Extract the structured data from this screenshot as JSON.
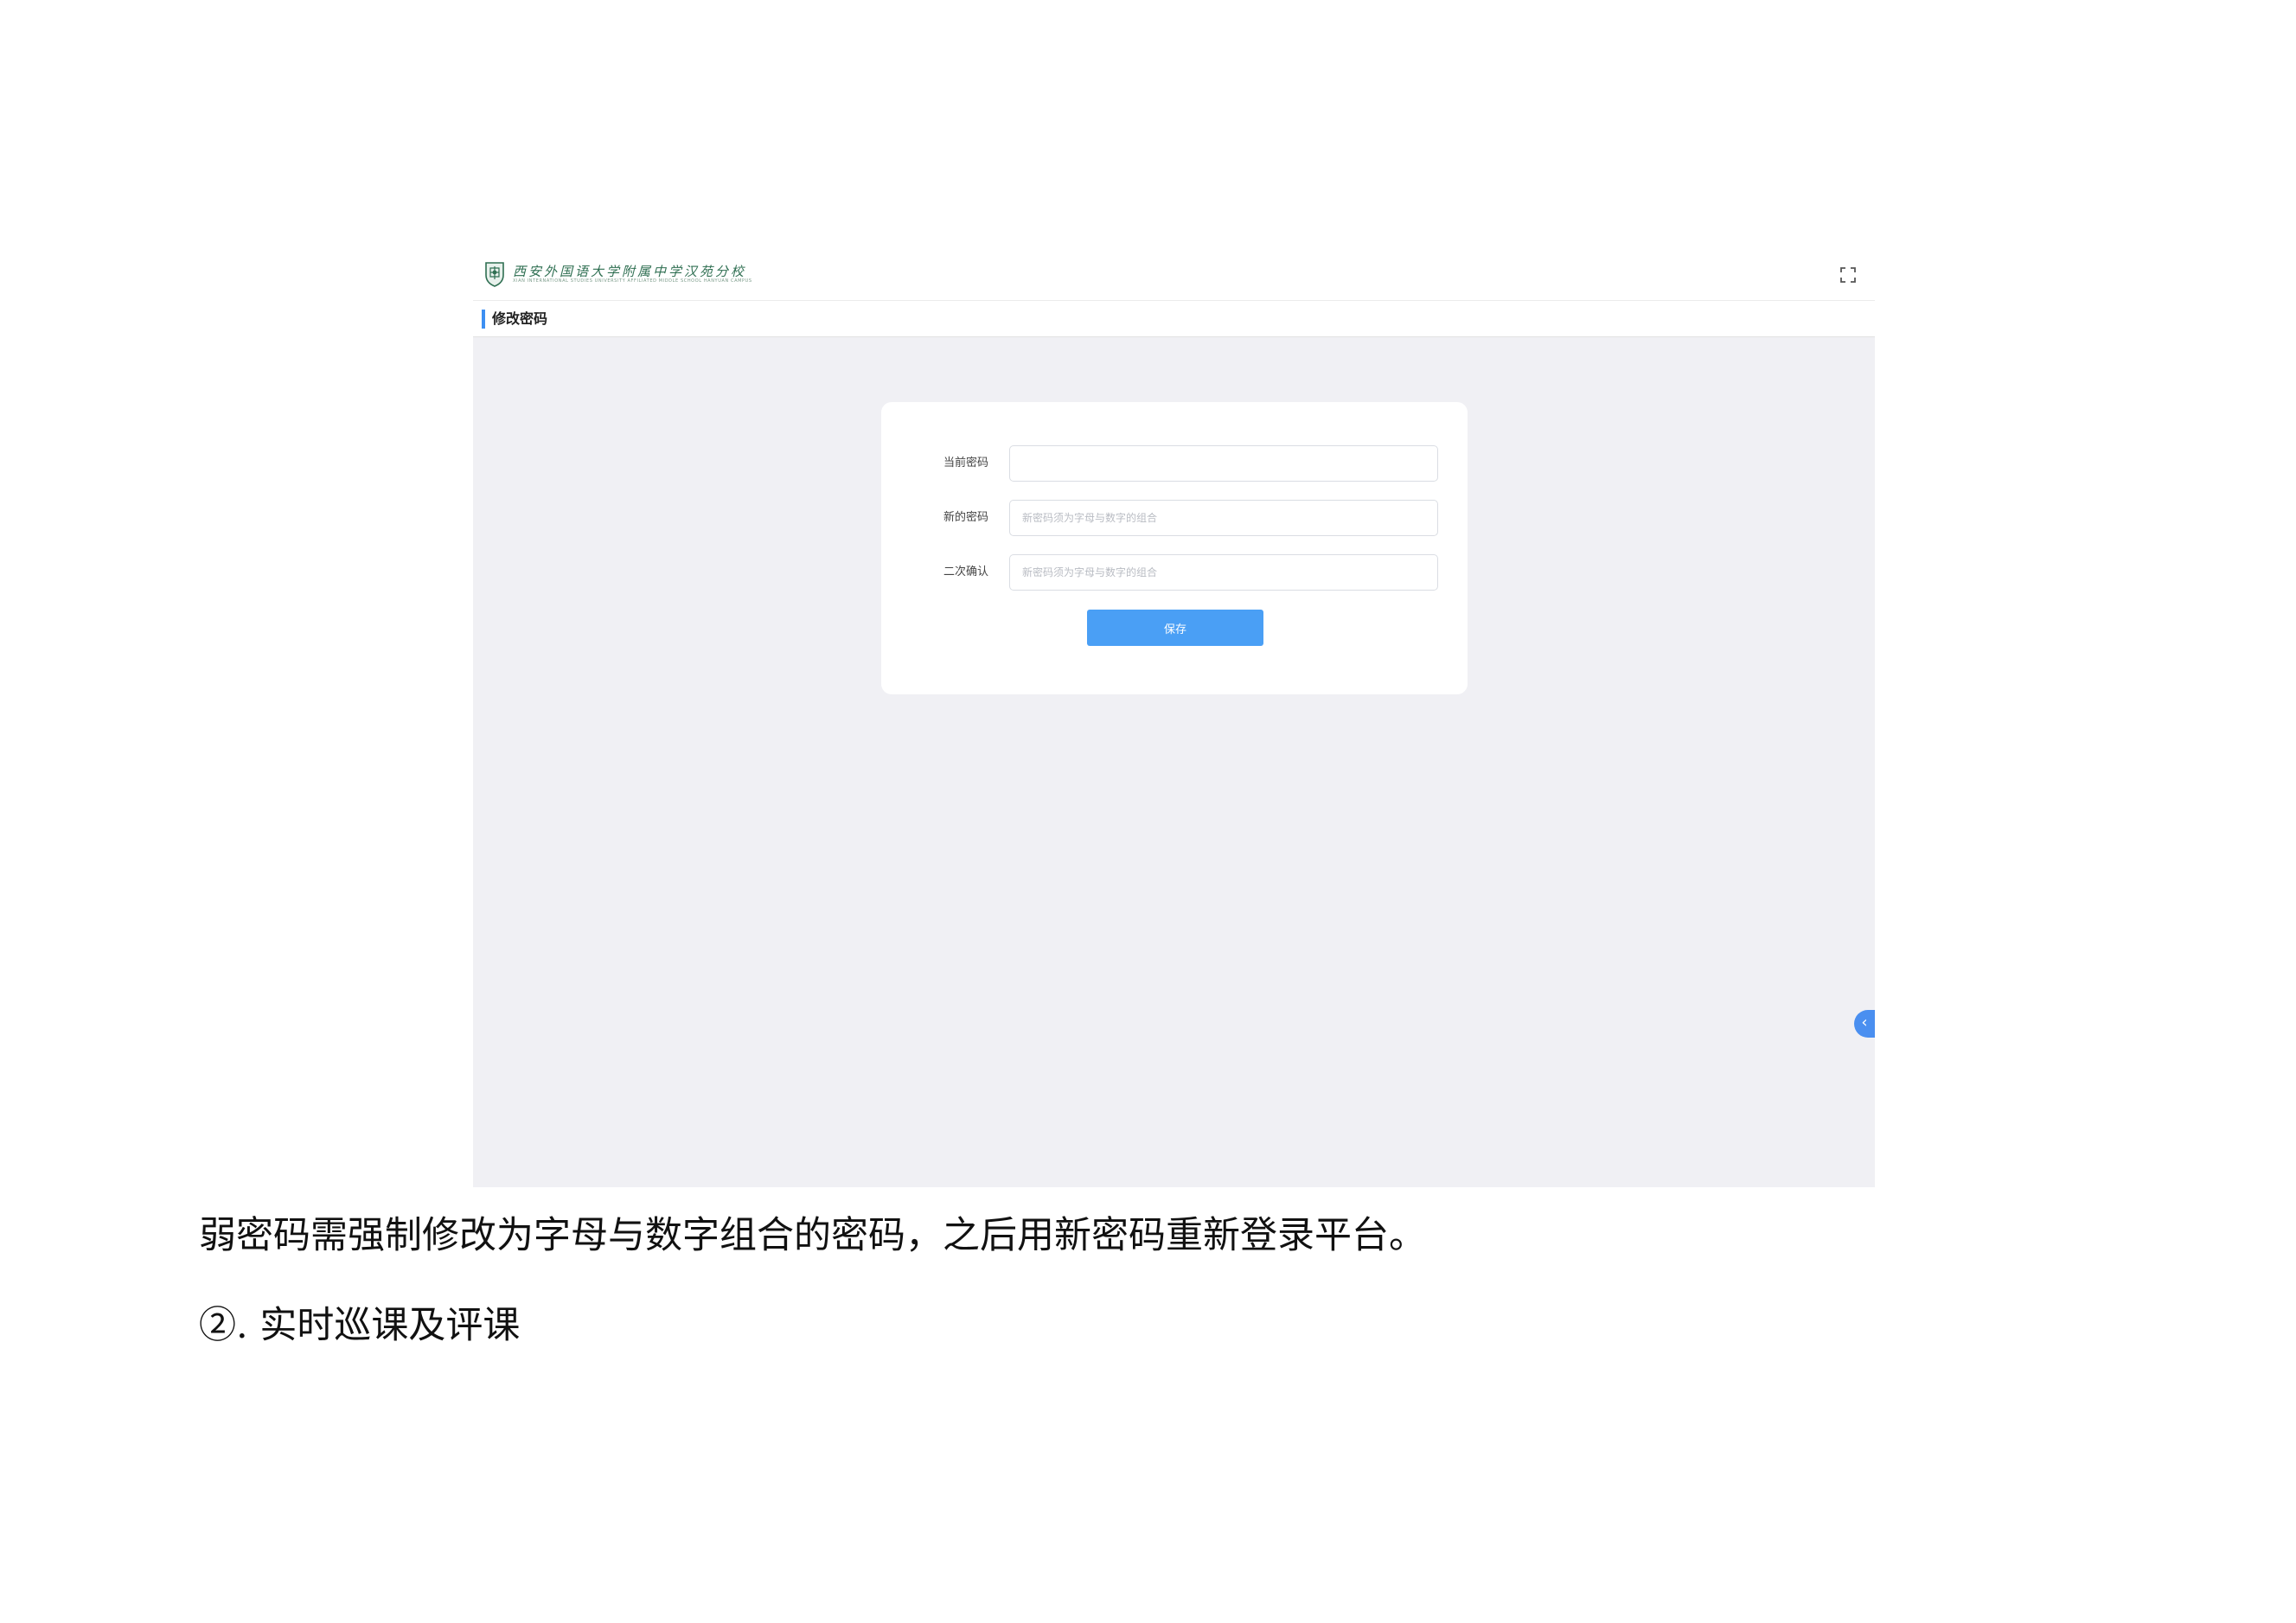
{
  "screenshot": {
    "topbar": {
      "logo_main": "西安外国语大学附属中学汉苑分校",
      "logo_sub": "XIAN INTERNATIONAL STUDIES UNIVERSITY AFFILIATED MIDDLE SCHOOL HANYUAN CAMPUS",
      "fullscreen_icon": "fullscreen-icon"
    },
    "page_title": "修改密码",
    "form": {
      "current_password": {
        "label": "当前密码",
        "value": "",
        "placeholder": ""
      },
      "new_password": {
        "label": "新的密码",
        "value": "",
        "placeholder": "新密码须为字母与数字的组合"
      },
      "confirm_password": {
        "label": "二次确认",
        "value": "",
        "placeholder": "新密码须为字母与数字的组合"
      },
      "save_label": "保存"
    },
    "side_toggle": "‹",
    "colors": {
      "accent": "#3d8ff2",
      "button": "#4a9ff5",
      "background": "#f0f0f4",
      "logo": "#2f6f52"
    }
  },
  "document": {
    "paragraph_1": "弱密码需强制修改为字母与数字组合的密码，之后用新密码重新登录平台。",
    "paragraph_2": "②. 实时巡课及评课"
  }
}
